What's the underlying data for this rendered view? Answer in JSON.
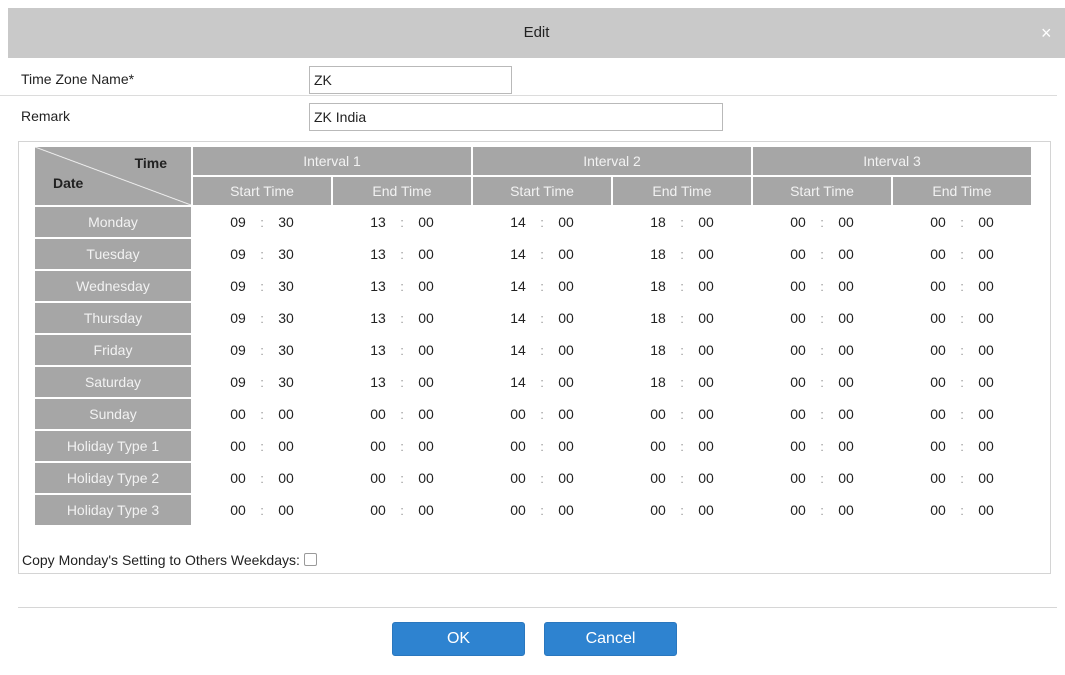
{
  "dialog": {
    "title": "Edit",
    "close_glyph": "×"
  },
  "fields": {
    "name_label": "Time Zone Name*",
    "name_value": "ZK",
    "remark_label": "Remark",
    "remark_value": "ZK India"
  },
  "table": {
    "corner_time": "Time",
    "corner_date": "Date",
    "intervals": [
      "Interval 1",
      "Interval 2",
      "Interval 3"
    ],
    "start_label": "Start Time",
    "end_label": "End Time",
    "rows": [
      {
        "day": "Monday",
        "times": [
          [
            "09",
            "30"
          ],
          [
            "13",
            "00"
          ],
          [
            "14",
            "00"
          ],
          [
            "18",
            "00"
          ],
          [
            "00",
            "00"
          ],
          [
            "00",
            "00"
          ]
        ]
      },
      {
        "day": "Tuesday",
        "times": [
          [
            "09",
            "30"
          ],
          [
            "13",
            "00"
          ],
          [
            "14",
            "00"
          ],
          [
            "18",
            "00"
          ],
          [
            "00",
            "00"
          ],
          [
            "00",
            "00"
          ]
        ]
      },
      {
        "day": "Wednesday",
        "times": [
          [
            "09",
            "30"
          ],
          [
            "13",
            "00"
          ],
          [
            "14",
            "00"
          ],
          [
            "18",
            "00"
          ],
          [
            "00",
            "00"
          ],
          [
            "00",
            "00"
          ]
        ]
      },
      {
        "day": "Thursday",
        "times": [
          [
            "09",
            "30"
          ],
          [
            "13",
            "00"
          ],
          [
            "14",
            "00"
          ],
          [
            "18",
            "00"
          ],
          [
            "00",
            "00"
          ],
          [
            "00",
            "00"
          ]
        ]
      },
      {
        "day": "Friday",
        "times": [
          [
            "09",
            "30"
          ],
          [
            "13",
            "00"
          ],
          [
            "14",
            "00"
          ],
          [
            "18",
            "00"
          ],
          [
            "00",
            "00"
          ],
          [
            "00",
            "00"
          ]
        ]
      },
      {
        "day": "Saturday",
        "times": [
          [
            "09",
            "30"
          ],
          [
            "13",
            "00"
          ],
          [
            "14",
            "00"
          ],
          [
            "18",
            "00"
          ],
          [
            "00",
            "00"
          ],
          [
            "00",
            "00"
          ]
        ]
      },
      {
        "day": "Sunday",
        "times": [
          [
            "00",
            "00"
          ],
          [
            "00",
            "00"
          ],
          [
            "00",
            "00"
          ],
          [
            "00",
            "00"
          ],
          [
            "00",
            "00"
          ],
          [
            "00",
            "00"
          ]
        ]
      },
      {
        "day": "Holiday Type 1",
        "times": [
          [
            "00",
            "00"
          ],
          [
            "00",
            "00"
          ],
          [
            "00",
            "00"
          ],
          [
            "00",
            "00"
          ],
          [
            "00",
            "00"
          ],
          [
            "00",
            "00"
          ]
        ]
      },
      {
        "day": "Holiday Type 2",
        "times": [
          [
            "00",
            "00"
          ],
          [
            "00",
            "00"
          ],
          [
            "00",
            "00"
          ],
          [
            "00",
            "00"
          ],
          [
            "00",
            "00"
          ],
          [
            "00",
            "00"
          ]
        ]
      },
      {
        "day": "Holiday Type 3",
        "times": [
          [
            "00",
            "00"
          ],
          [
            "00",
            "00"
          ],
          [
            "00",
            "00"
          ],
          [
            "00",
            "00"
          ],
          [
            "00",
            "00"
          ],
          [
            "00",
            "00"
          ]
        ]
      }
    ]
  },
  "copy_label": "Copy Monday's Setting to Others Weekdays:",
  "copy_checked": false,
  "buttons": {
    "ok": "OK",
    "cancel": "Cancel"
  },
  "colors": {
    "header_bg": "#a6a6a6",
    "title_bar": "#c9c9c9",
    "button_bg": "#2e83d0"
  }
}
